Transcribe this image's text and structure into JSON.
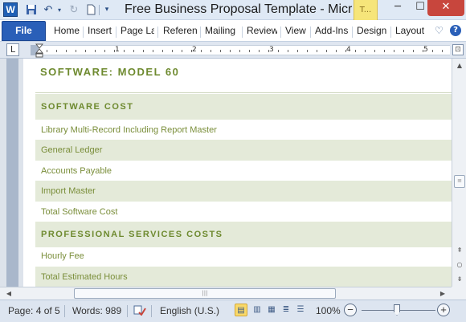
{
  "titlebar": {
    "app_icon_letter": "W",
    "title": "Free Business Proposal Template  -  Micr",
    "context_tab": "T...",
    "minimize": "─",
    "maximize": "☐",
    "close": "✕"
  },
  "ribbon": {
    "file_label": "File",
    "tabs": [
      "Home",
      "Insert",
      "Page Layout",
      "Referen",
      "Mailing",
      "Review",
      "View",
      "Add-Ins",
      "Design",
      "Layout"
    ]
  },
  "ruler": {
    "tab_selector": "L",
    "numbers": [
      "1",
      "2",
      "3",
      "4",
      "5"
    ]
  },
  "document": {
    "heading": "SOFTWARE: MODEL 60",
    "rows": [
      {
        "text": "SOFTWARE COST",
        "type": "section"
      },
      {
        "text": "Library Multi-Record Including Report Master",
        "type": "plain"
      },
      {
        "text": "General Ledger",
        "type": "band"
      },
      {
        "text": "Accounts Payable",
        "type": "plain"
      },
      {
        "text": "Import Master",
        "type": "band"
      },
      {
        "text": "Total Software Cost",
        "type": "plain"
      },
      {
        "text": "PROFESSIONAL SERVICES COSTS",
        "type": "section"
      },
      {
        "text": "Hourly Fee",
        "type": "plain"
      },
      {
        "text": "Total Estimated Hours",
        "type": "band"
      }
    ]
  },
  "statusbar": {
    "page": "Page: 4 of 5",
    "words": "Words: 989",
    "language": "English (U.S.)",
    "zoom": "100%",
    "zoom_level": 1.0
  },
  "colors": {
    "accent_green": "#6e8a2f",
    "band_green": "#e4ead9",
    "file_tab_blue": "#2a5fb8",
    "close_red": "#c8463d"
  }
}
